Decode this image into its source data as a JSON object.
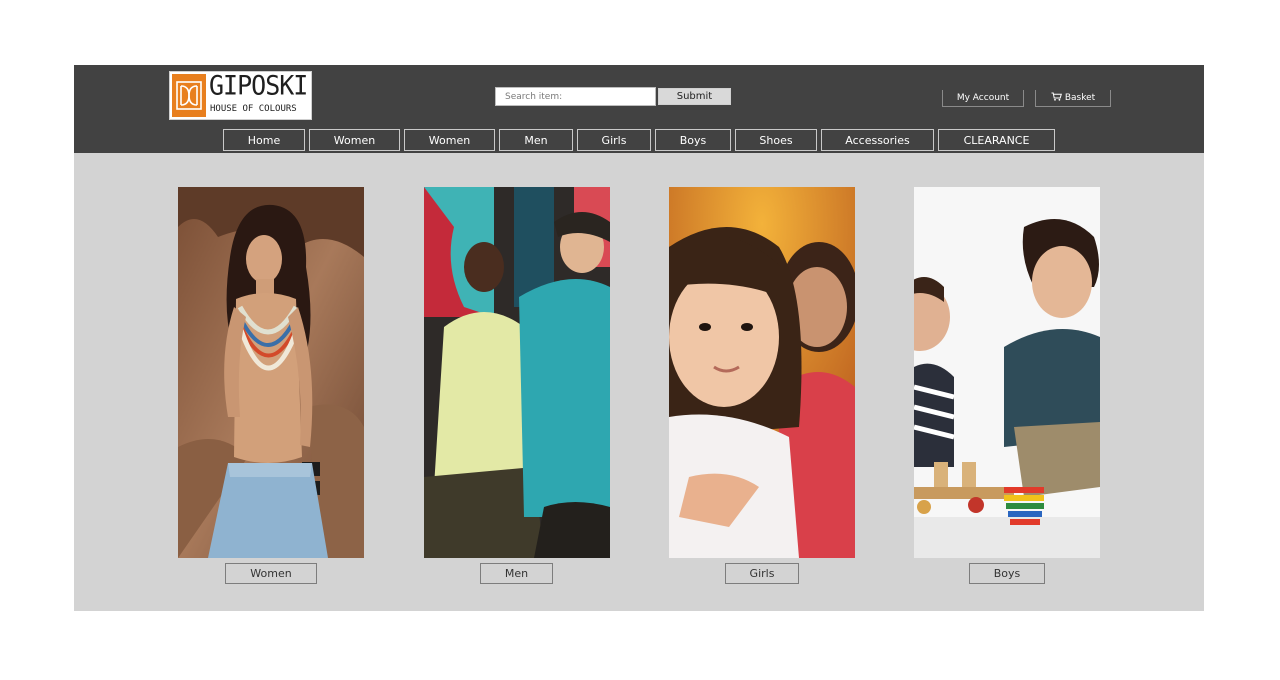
{
  "brand": {
    "name": "GIPOSKI",
    "tagline": "HOUSE OF COLOURS",
    "accent_color": "#e87f1e"
  },
  "search": {
    "placeholder": "Search item:",
    "value": "",
    "submit_label": "Submit"
  },
  "account": {
    "my_account_label": "My Account",
    "basket_label": "Basket",
    "basket_icon": "basket-icon"
  },
  "nav": {
    "items": [
      {
        "label": "Home"
      },
      {
        "label": "Women"
      },
      {
        "label": "Women"
      },
      {
        "label": "Men"
      },
      {
        "label": "Girls"
      },
      {
        "label": "Boys"
      },
      {
        "label": "Shoes"
      },
      {
        "label": "Accessories"
      },
      {
        "label": "CLEARANCE"
      }
    ]
  },
  "categories": [
    {
      "label": "Women",
      "image": "woman-photo"
    },
    {
      "label": "Men",
      "image": "men-photo"
    },
    {
      "label": "Girls",
      "image": "girls-photo"
    },
    {
      "label": "Boys",
      "image": "boys-photo"
    }
  ],
  "colors": {
    "header_bg": "#424242",
    "page_bg": "#d3d3d3",
    "nav_border": "#c9c9c9"
  }
}
